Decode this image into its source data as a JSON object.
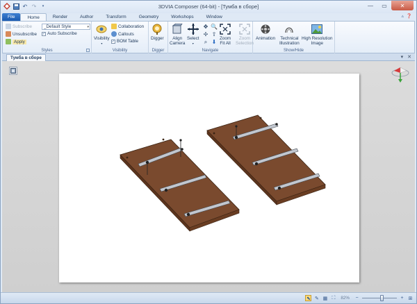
{
  "window": {
    "title": "3DVIA Composer (64-bit) - [Тумба в сборе]"
  },
  "quick_access": {
    "icons": [
      "save-icon",
      "undo-icon",
      "redo-icon",
      "customize-icon"
    ]
  },
  "tabs": [
    {
      "label": "File"
    },
    {
      "label": "Home"
    },
    {
      "label": "Render"
    },
    {
      "label": "Author"
    },
    {
      "label": "Transform"
    },
    {
      "label": "Geometry"
    },
    {
      "label": "Workshops"
    },
    {
      "label": "Window"
    }
  ],
  "active_tab": "Home",
  "ribbon": {
    "styles": {
      "label": "Styles",
      "subscribe": "Subscribe",
      "unsubscribe": "Unsubscribe",
      "apply": "Apply",
      "style_combo": "_Default Style",
      "auto_subscribe": "Auto Subscribe"
    },
    "visibility": {
      "label": "Visibility",
      "visibility_btn": "Visibility",
      "collaboration": "Collaboration",
      "callouts": "Callouts",
      "bom_table": "BOM Table"
    },
    "digger": {
      "label": "Digger",
      "digger_btn": "Digger"
    },
    "navigate": {
      "label": "Navigate",
      "align_camera_1": "Align",
      "align_camera_2": "Camera",
      "select": "Select",
      "zoom_fit_1": "Zoom",
      "zoom_fit_2": "Fit All",
      "zoom_sel_1": "Zoom",
      "zoom_sel_2": "Selection"
    },
    "showhide": {
      "label": "Show/Hide",
      "animation": "Animation",
      "tech_illus_1": "Technical",
      "tech_illus_2": "Illustration",
      "hires_1": "High Resolution",
      "hires_2": "Image"
    }
  },
  "document": {
    "tab_label": "Тумба в сборе"
  },
  "statusbar": {
    "zoom": "82%"
  },
  "colors": {
    "file_tab": "#2a6bc2",
    "wood": "#7a4a2e",
    "rail": "#b9bfc8"
  }
}
